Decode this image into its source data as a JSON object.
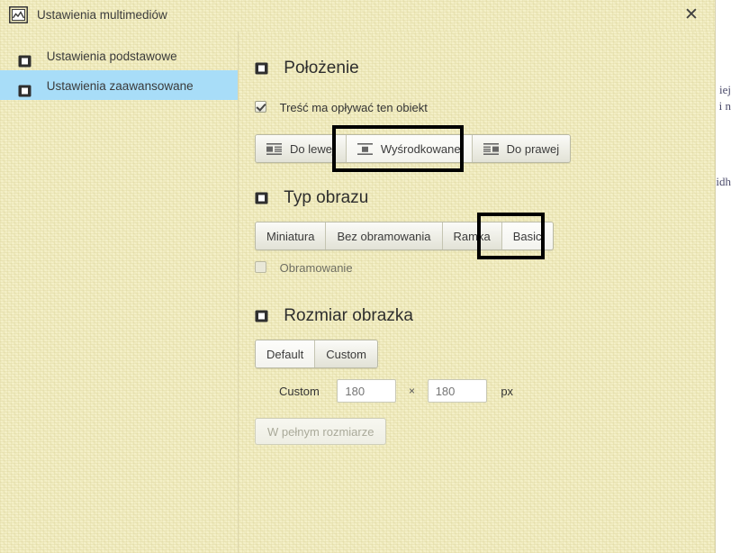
{
  "window": {
    "title": "Ustawienia multimediów",
    "icon": "image-icon",
    "close_label": "✕"
  },
  "behind_page": {
    "line1": "iej",
    "line2": "i n",
    "line3": "idh"
  },
  "sidebar": {
    "items": [
      {
        "label": "Ustawienia podstawowe",
        "icon": "square-icon",
        "selected": false
      },
      {
        "label": "Ustawienia zaawansowane",
        "icon": "square-icon",
        "selected": true
      }
    ]
  },
  "sections": {
    "position": {
      "heading": "Położenie",
      "heading_icon": "square-icon",
      "wrap_checkbox": {
        "label": "Treść ma opływać ten obiekt",
        "checked": true
      },
      "alignment": {
        "options": [
          {
            "label": "Do lewej",
            "icon": "align-left-icon",
            "active": false
          },
          {
            "label": "Wyśrodkowane",
            "icon": "align-center-icon",
            "active": true
          },
          {
            "label": "Do prawej",
            "icon": "align-right-icon",
            "active": false
          }
        ],
        "focused_index": 1
      }
    },
    "image_type": {
      "heading": "Typ obrazu",
      "heading_icon": "square-icon",
      "options": [
        {
          "label": "Miniatura",
          "active": false
        },
        {
          "label": "Bez obramowania",
          "active": false
        },
        {
          "label": "Ramka",
          "active": false
        },
        {
          "label": "Basic",
          "active": true
        }
      ],
      "focused_index": 3,
      "border_checkbox": {
        "label": "Obramowanie",
        "checked": false,
        "disabled": true
      }
    },
    "image_size": {
      "heading": "Rozmiar obrazka",
      "heading_icon": "square-icon",
      "mode_options": [
        {
          "label": "Default",
          "active": true
        },
        {
          "label": "Custom",
          "active": false
        }
      ],
      "custom_row": {
        "label": "Custom",
        "width_value": "",
        "width_placeholder": "180",
        "separator": "×",
        "height_value": "",
        "height_placeholder": "180",
        "unit": "px"
      },
      "full_size_button": {
        "label": "W pełnym rozmiarze",
        "disabled": true
      }
    }
  },
  "colors": {
    "paper": "#f4f0c8",
    "selection": "#a8ddf8",
    "focus_ring": "#000000",
    "text": "#333333"
  }
}
